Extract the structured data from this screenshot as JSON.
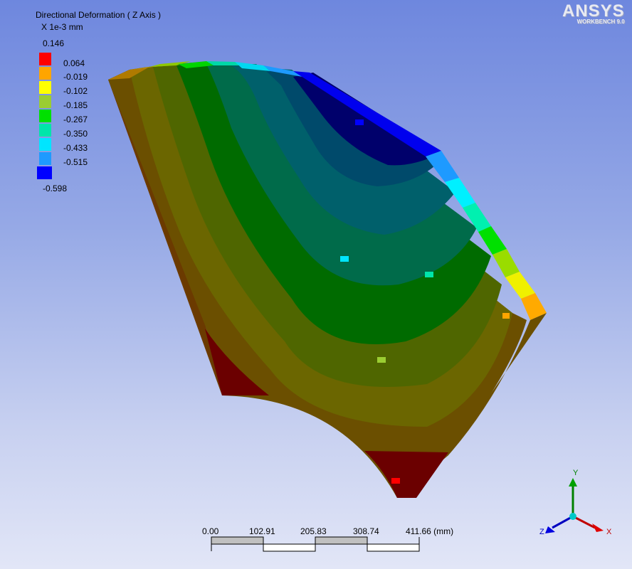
{
  "legend": {
    "title": "Directional Deformation ( Z Axis )",
    "units": "X 1e-3 mm",
    "max_label": "0.146",
    "min_label": "-0.598",
    "levels": [
      {
        "label": "0.064",
        "color": "#ff0000"
      },
      {
        "label": "-0.019",
        "color": "#ffa500"
      },
      {
        "label": "-0.102",
        "color": "#ffff00"
      },
      {
        "label": "-0.185",
        "color": "#9acd32"
      },
      {
        "label": "-0.267",
        "color": "#00e000"
      },
      {
        "label": "-0.350",
        "color": "#00e5aa"
      },
      {
        "label": "-0.433",
        "color": "#00e5ff"
      },
      {
        "label": "-0.515",
        "color": "#1e9aff"
      },
      {
        "label": "",
        "color": "#0000ff"
      }
    ]
  },
  "logo": {
    "main": "ANSYS",
    "sub": "WORKBENCH 9.0"
  },
  "scale_bar": {
    "ticks": [
      "0.00",
      "102.91",
      "205.83",
      "308.74"
    ],
    "last_tick": "411.66 (mm)"
  },
  "triad": {
    "x": "X",
    "y": "Y",
    "z": "Z"
  },
  "contour_colors": {
    "face": [
      "#6b3a00",
      "#6b4f00",
      "#6b6600",
      "#4f6600",
      "#006b00",
      "#006b4a",
      "#00606b",
      "#004a6b",
      "#00006b"
    ],
    "edge": [
      "#ff0000",
      "#ffa500",
      "#ffff00",
      "#9acd32",
      "#00e000",
      "#00e5aa",
      "#00e5ff",
      "#1e9aff",
      "#0000ff"
    ]
  }
}
